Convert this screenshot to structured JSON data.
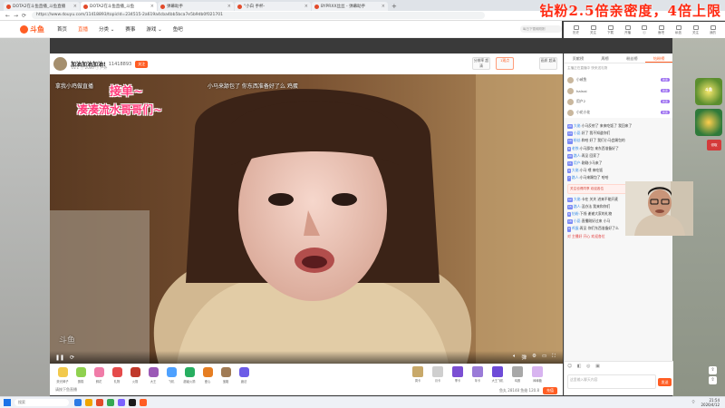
{
  "browser": {
    "tabs": [
      {
        "label": "DOTA2在斗鱼直播_斗鱼直播",
        "active": false
      },
      {
        "label": "DOTA2在斗鱼直播_斗鱼",
        "active": true
      },
      {
        "label": "弹幕助手",
        "active": false
      },
      {
        "label": "\"小白 手杯-",
        "active": false
      },
      {
        "label": "BYPRXX丝丝 - 弹幕助手",
        "active": false
      }
    ],
    "new_tab": "+",
    "url": "https://www.douyu.com/11418893/topicId=234515-2a619a4cba4bb5bca7e5b9db0f021701"
  },
  "banner": {
    "text": "钻粉2.5倍亲密度，4倍上限"
  },
  "site": {
    "logo": "斗鱼",
    "nav": [
      "首页",
      "直播",
      "分类 ⌄",
      "赛事",
      "游戏 ⌄",
      "鱼吧"
    ],
    "search_placeholder": "每日下雪阁刚刚",
    "header_icons": [
      "历史",
      "关注",
      "下载",
      "开播",
      "ⓒ",
      "鱼吧",
      "私信",
      "关注",
      "我的"
    ]
  },
  "stream": {
    "title": "加油加油加油!",
    "room_id": "11418893",
    "follow_label": "关注",
    "meta": "Lv.1  ⓘ 2000  ⓘ  户外",
    "qualities": [
      "分辨率 超清",
      "1观点",
      "画质 超清"
    ],
    "overlay_left": "拿我小鸡做直播",
    "overlay_right": "小马来舔包了 你东西准备好了么 鸡蛋",
    "handwriting_1": "接单~",
    "handwriting_2": "凑凑流水哥哥们~",
    "watermark": "斗鱼"
  },
  "gifts": {
    "left": [
      {
        "label": "荧光棒子",
        "color": "#f2c94c"
      },
      {
        "label": "蛋糕",
        "color": "#8fd14f"
      },
      {
        "label": "鲜花",
        "color": "#f07ca8"
      },
      {
        "label": "礼物",
        "color": "#e54b4b"
      },
      {
        "label": "火箭",
        "color": "#c0392b"
      },
      {
        "label": "大王",
        "color": "#9b59b6"
      },
      {
        "label": "飞机",
        "color": "#4ea1ff"
      },
      {
        "label": "超级火箭",
        "color": "#27ae60"
      },
      {
        "label": "爱心",
        "color": "#e67e22"
      },
      {
        "label": "宝箱",
        "color": "#a07b55"
      },
      {
        "label": "魔法",
        "color": "#6c5ce7"
      }
    ],
    "right": [
      {
        "label": "周卡",
        "color": "#c8a96a"
      },
      {
        "label": "月卡",
        "color": "#cfcfcf"
      },
      {
        "label": "季卡",
        "color": "#7b4fd3"
      },
      {
        "label": "年卡",
        "color": "#9a7bd8"
      },
      {
        "label": "大王飞机",
        "color": "#6e4bd8"
      },
      {
        "label": "鸡蛋",
        "color": "#a8a8a8"
      },
      {
        "label": "棒棒糖",
        "color": "#d8b4f0"
      }
    ],
    "footer_left": "请按下鱼直播",
    "balance_text": "鱼丸 28148  鱼翅 120.8",
    "pay_label": "充值"
  },
  "chat": {
    "tabs": [
      "贡献榜",
      "周榜",
      "粉丝榜",
      "钻粉榜"
    ],
    "active_tab": 3,
    "rank_header": "主播正在直播中 快来送礼物",
    "ranks": [
      {
        "name": "小咸鱼",
        "badge": "新贵"
      },
      {
        "name": "halnai",
        "badge": "新贵"
      },
      {
        "name": "用户2",
        "badge": "新贵"
      },
      {
        "name": "小花小花",
        "badge": "新贵"
      }
    ],
    "messages": [
      {
        "badge": "20",
        "name": "大佬:",
        "text": "小马反射了 来来吃饭了 我回来了"
      },
      {
        "badge": "14",
        "name": "小夏:",
        "text": "好了 我不知道你们"
      },
      {
        "badge": "10",
        "name": "粉丝:",
        "text": "和哈 好了 我们小马会踢包的"
      },
      {
        "badge": "8",
        "name": "老铁:",
        "text": "小马舔包 来东西准备好了"
      },
      {
        "badge": "20",
        "name": "路人:",
        "text": "再见 回家了"
      },
      {
        "badge": "11",
        "name": "用户:",
        "text": "刚刚小马来了"
      },
      {
        "badge": "9",
        "name": "大佬:",
        "text": "小马 喂 来吃饭"
      },
      {
        "badge": "7",
        "name": "路人:",
        "text": "小马来踢包了 哈哈"
      }
    ],
    "notice": "关注也得同享 欢迎各位",
    "messages2": [
      {
        "badge": "12",
        "name": "大佬:",
        "text": "卡在 关关 进来不能开麦"
      },
      {
        "badge": "15",
        "name": "路人:",
        "text": "没办法 我来和你们"
      },
      {
        "badge": "6",
        "name": "钻粉:",
        "text": "下线 谢谢大家的礼物"
      },
      {
        "badge": "18",
        "name": "小夏:",
        "text": "直播刚好过来 小马"
      },
      {
        "badge": "9",
        "name": "鸡蛋:",
        "text": "再见 你们东西准备好了么"
      }
    ],
    "system": "对 主播好 开心 欢迎各位",
    "input_placeholder": "这里输入聊天内容",
    "send_label": "发送",
    "icons": "☺ ◧ ◎ ▣"
  },
  "right": {
    "promo_text": "斗鱼",
    "promo3": "领取"
  },
  "taskbar": {
    "search": "搜索",
    "time": "21:54",
    "date": "2026/4/12"
  }
}
